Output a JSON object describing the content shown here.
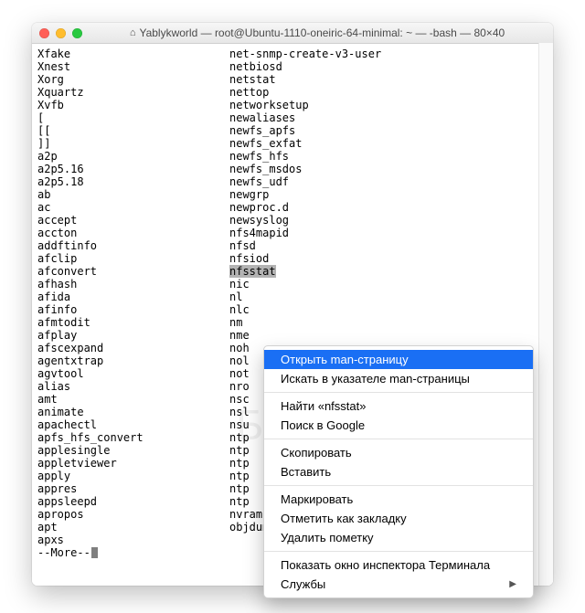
{
  "window": {
    "title": "Yablykworld — root@Ubuntu-1110-oneiric-64-minimal: ~ — -bash — 80×40"
  },
  "columns": {
    "left": [
      "Xfake",
      "Xnest",
      "Xorg",
      "Xquartz",
      "Xvfb",
      "[",
      "[[",
      "]]",
      "a2p",
      "a2p5.16",
      "a2p5.18",
      "ab",
      "ac",
      "accept",
      "accton",
      "addftinfo",
      "afclip",
      "afconvert",
      "afhash",
      "afida",
      "afinfo",
      "afmtodit",
      "afplay",
      "afscexpand",
      "agentxtrap",
      "agvtool",
      "alias",
      "amt",
      "animate",
      "apachectl",
      "apfs_hfs_convert",
      "applesingle",
      "appletviewer",
      "apply",
      "appres",
      "appsleepd",
      "apropos",
      "apt",
      "apxs"
    ],
    "right": [
      "net-snmp-create-v3-user",
      "netbiosd",
      "netstat",
      "nettop",
      "networksetup",
      "newaliases",
      "newfs_apfs",
      "newfs_exfat",
      "newfs_hfs",
      "newfs_msdos",
      "newfs_udf",
      "newgrp",
      "newproc.d",
      "newsyslog",
      "nfs4mapid",
      "nfsd",
      "nfsiod",
      "nfsstat",
      "nic",
      "nl",
      "nlc",
      "nm",
      "nme",
      "noh",
      "nol",
      "not",
      "nro",
      "nsc",
      "nsl",
      "nsu",
      "ntp",
      "ntp",
      "ntp",
      "ntp",
      "ntp",
      "ntp",
      "nvram",
      "objdump"
    ],
    "right_visible_from_index": 36,
    "selected_right_index": 17
  },
  "more_label": "--More--",
  "context_menu": {
    "items": [
      {
        "label": "Открыть man-страницу",
        "selected": true
      },
      {
        "label": "Искать в указателе man-страницы"
      },
      {
        "sep": true
      },
      {
        "label": "Найти «nfsstat»"
      },
      {
        "label": "Поиск в Google"
      },
      {
        "sep": true
      },
      {
        "label": "Скопировать"
      },
      {
        "label": "Вставить"
      },
      {
        "sep": true
      },
      {
        "label": "Маркировать"
      },
      {
        "label": "Отметить как закладку"
      },
      {
        "label": "Удалить пометку"
      },
      {
        "sep": true
      },
      {
        "label": "Показать окно инспектора Терминала"
      },
      {
        "label": "Службы",
        "submenu": true
      }
    ]
  },
  "watermark": {
    "text": "БЛЫК"
  }
}
